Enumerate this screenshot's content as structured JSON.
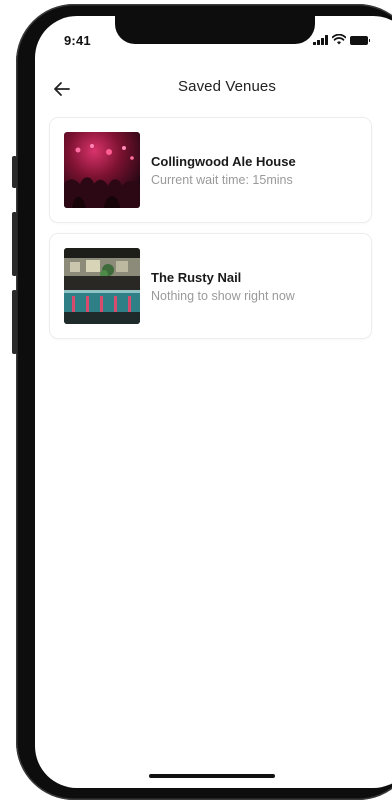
{
  "status_bar": {
    "time": "9:41"
  },
  "header": {
    "title": "Saved Venues",
    "back_icon": "arrow-left-icon"
  },
  "venues": [
    {
      "name": "Collingwood Ale House",
      "status": "Current wait time: 15mins",
      "photo": "pub-interior-red-lights-photo"
    },
    {
      "name": "The Rusty Nail",
      "status": "Nothing to show right now",
      "photo": "bar-counter-teal-photo"
    }
  ],
  "colors": {
    "card_border": "#ededed",
    "title_text": "#1a1a1a",
    "secondary_text": "#9a9a9a"
  }
}
